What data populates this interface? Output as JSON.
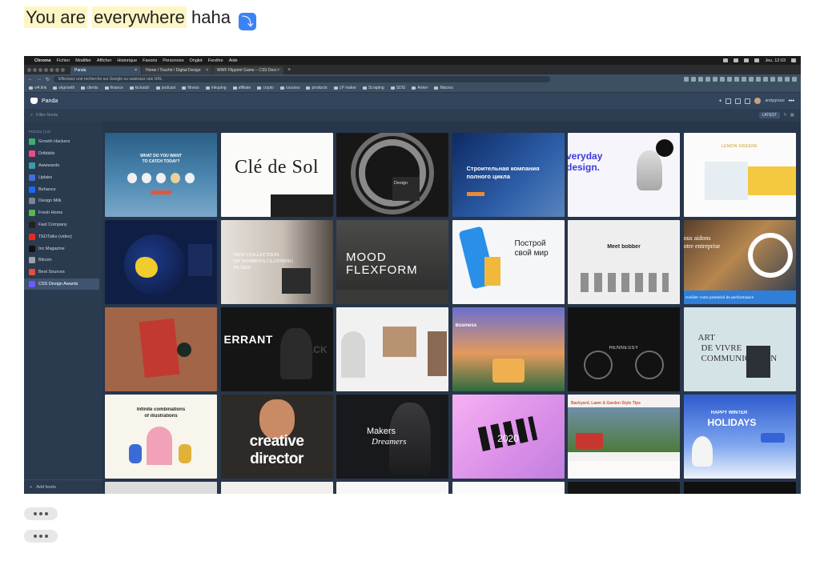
{
  "message": {
    "part1": "You are",
    "part2": "everywhere",
    "part3": "haha",
    "emoji": "⤵"
  },
  "screenshot": {
    "menubar": {
      "apple": "",
      "app": "Chrome",
      "items": [
        "Fichier",
        "Modifier",
        "Afficher",
        "Historique",
        "Favoris",
        "Personnes",
        "Onglet",
        "Fenêtre",
        "Aide"
      ],
      "clock": "Jeu. 12:03"
    },
    "tabs": [
      {
        "label": "Panda"
      },
      {
        "label": "Home / Touché / Digital Design"
      },
      {
        "label": "WWF Flipprint Game – CSS Desi"
      }
    ],
    "tab_close": "×",
    "new_tab": "+",
    "address": {
      "placeholder": "Effectuez une recherche sur Google ou saisissez une URL"
    },
    "bookmarks": [
      "vi4.link",
      "skgrowth",
      "clients",
      "finance",
      "kickads!",
      "podcast",
      "fitness",
      "mkuping",
      "affiliate",
      "crypto",
      "courses",
      "products",
      "LP maker",
      "Scraping",
      "SDIS",
      "Anker",
      "Macros"
    ],
    "panda": {
      "title": "Panda",
      "username": "andygrossi",
      "filter_placeholder": "Filter feeds",
      "latest": "LATEST",
      "sidebar_title": "FEEDS (13)",
      "feeds": [
        {
          "label": "Growth Hackers",
          "color": "#3bb26a"
        },
        {
          "label": "Dribbble",
          "color": "#ea4c89"
        },
        {
          "label": "Awwwards",
          "color": "#3a9ea5"
        },
        {
          "label": "Uplabs",
          "color": "#3d6fe0"
        },
        {
          "label": "Behance",
          "color": "#1769ff"
        },
        {
          "label": "Design Milk",
          "color": "#7a8593"
        },
        {
          "label": "Fresh Home",
          "color": "#57b84f"
        },
        {
          "label": "Fast Company",
          "color": "#222222"
        },
        {
          "label": "TEDTalks (video)",
          "color": "#e62b1e"
        },
        {
          "label": "Inc Magazine",
          "color": "#111111"
        },
        {
          "label": "Bitcoin",
          "color": "#9aa3ad"
        },
        {
          "label": "Best Sources",
          "color": "#e74c3c"
        },
        {
          "label": "CSS Design Awards",
          "color": "#6a5cff"
        }
      ],
      "add_feeds": "Add feeds",
      "cards": [
        {
          "t1": "WHAT DO YOU WANT",
          "t2": "TO CATCH TODAY?"
        },
        {
          "t1": "Clé de Sol",
          "t2": ""
        },
        {
          "t1": "Design",
          "t2": ""
        },
        {
          "t1": "Строительная компания",
          "t2": "полного цикла"
        },
        {
          "t1": "veryday",
          "t2": "design."
        },
        {
          "t1": "LEMON GREENE",
          "t2": ""
        },
        {
          "t1": "",
          "t2": ""
        },
        {
          "t1": "NEW COLLECTION",
          "t2": "OF WOMEN'S CLOTHING",
          "t3": "SS 2020"
        },
        {
          "t1": "MOOD",
          "t2": "FLEXFORM"
        },
        {
          "t1": "Построй",
          "t2": "свой мир"
        },
        {
          "t1": "Meet bobber",
          "t2": ""
        },
        {
          "t1": "ous aidons",
          "t2": "otre entreprise",
          "t3": "eveiller votre potentiel de performance"
        },
        {
          "t1": "",
          "t2": ""
        },
        {
          "t1": "ERRANT",
          "t2": "PACK"
        },
        {
          "t1": "",
          "t2": ""
        },
        {
          "t1": "Business",
          "t2": ""
        },
        {
          "t1": "HENNESSY",
          "t2": ""
        },
        {
          "t1": "ART",
          "t2": "DE VIVRE",
          "t3": "COMMUNICATION"
        },
        {
          "t1": "Infinite combinations",
          "t2": "of illustrations"
        },
        {
          "t1": "creative",
          "t2": "director"
        },
        {
          "t1": "Makers",
          "t2": "Dreamers"
        },
        {
          "t1": "2020",
          "t2": ""
        },
        {
          "t1": "Backyard, Lawn & Garden Style Tips",
          "t2": ""
        },
        {
          "t1": "HAPPY WINTER",
          "t2": "HOLIDAYS"
        }
      ]
    }
  }
}
